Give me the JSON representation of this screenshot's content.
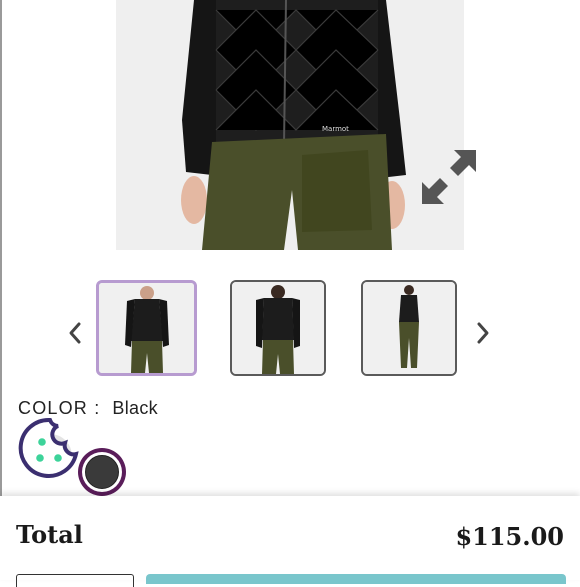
{
  "product": {
    "color_label": "COLOR :",
    "color_value": "Black",
    "thumbnails": [
      "front view",
      "back view",
      "full length view"
    ]
  },
  "icons": {
    "expand": "expand-arrows-icon",
    "prev": "chevron-left-icon",
    "next": "chevron-right-icon",
    "cookie": "cookie-icon"
  },
  "colors": {
    "swatch_black": "#3a3a3a",
    "swatch_ring": "#5a1d5a",
    "cta": "#79c6cc",
    "thumb_selected": "#b79bd0"
  },
  "footer": {
    "total_label": "Total",
    "total_value": "$115.00"
  }
}
